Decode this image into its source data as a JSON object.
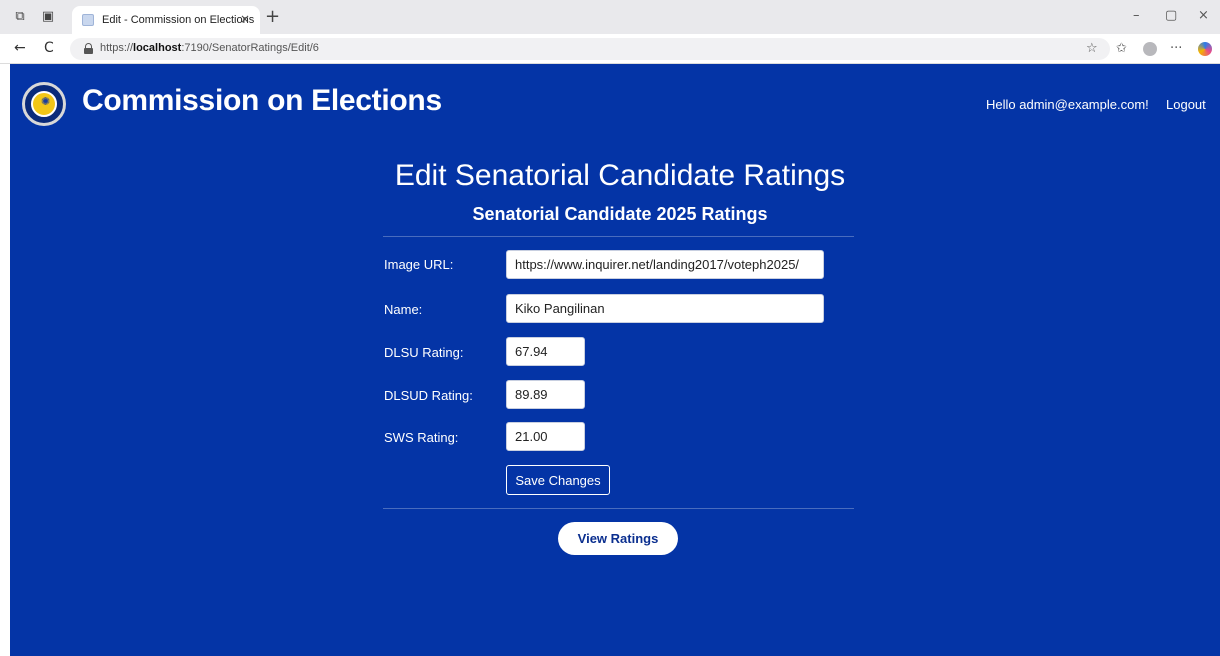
{
  "browser": {
    "tab_title": "Edit - Commission on Elections",
    "tab_close": "×",
    "new_tab": "+",
    "url_prefix": "https://",
    "url_host": "localhost",
    "url_path": ":7190/SenatorRatings/Edit/6",
    "back": "←",
    "refresh": "C",
    "minimize": "–",
    "restore": "▢",
    "close": "×",
    "favorite_icon": "☆",
    "favorites_icon": "✩",
    "more_icon": "···"
  },
  "header": {
    "brand": "Commission on Elections",
    "greeting": "Hello admin@example.com!",
    "logout_label": "Logout"
  },
  "form": {
    "title": "Edit Senatorial Candidate Ratings",
    "subtitle": "Senatorial Candidate 2025 Ratings",
    "fields": [
      {
        "label": "Image URL:",
        "value": "https://www.inquirer.net/landing2017/voteph2025/"
      },
      {
        "label": "Name:",
        "value": "Kiko Pangilinan"
      },
      {
        "label": "DLSU Rating:",
        "value": "67.94"
      },
      {
        "label": "DLSUD Rating:",
        "value": "89.89"
      },
      {
        "label": "SWS Rating:",
        "value": "21.00"
      }
    ],
    "save_label": "Save Changes",
    "view_label": "View Ratings"
  }
}
